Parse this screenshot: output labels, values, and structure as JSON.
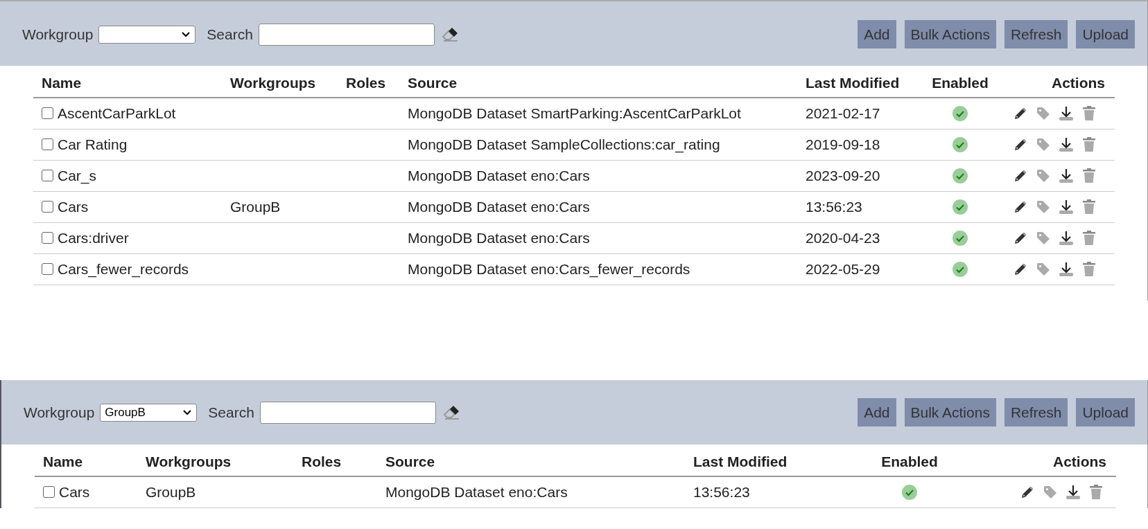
{
  "panels": [
    {
      "toolbar": {
        "workgroup_label": "Workgroup",
        "search_label": "Search",
        "buttons": [
          "Add",
          "Bulk Actions",
          "Refresh",
          "Upload"
        ]
      },
      "table": {
        "columns": [
          "Name",
          "Workgroups",
          "Roles",
          "Source",
          "Last Modified",
          "Enabled",
          "Actions"
        ],
        "rows": [
          {
            "checked": false,
            "name": "AscentCarParkLot",
            "workgroups": "",
            "roles": "",
            "source": "MongoDB Dataset SmartParking:AscentCarParkLot",
            "last_modified": "2021-02-17",
            "enabled": true
          },
          {
            "checked": false,
            "name": "Car Rating",
            "workgroups": "",
            "roles": "",
            "source": "MongoDB Dataset SampleCollections:car_rating",
            "last_modified": "2019-09-18",
            "enabled": true
          },
          {
            "checked": false,
            "name": "Car_s",
            "workgroups": "",
            "roles": "",
            "source": "MongoDB Dataset eno:Cars",
            "last_modified": "2023-09-20",
            "enabled": true
          },
          {
            "checked": false,
            "name": "Cars",
            "workgroups": "GroupB",
            "roles": "",
            "source": "MongoDB Dataset eno:Cars",
            "last_modified": "13:56:23",
            "enabled": true
          },
          {
            "checked": false,
            "name": "Cars:driver",
            "workgroups": "",
            "roles": "",
            "source": "MongoDB Dataset eno:Cars",
            "last_modified": "2020-04-23",
            "enabled": true
          },
          {
            "checked": false,
            "name": "Cars_fewer_records",
            "workgroups": "",
            "roles": "",
            "source": "MongoDB Dataset eno:Cars_fewer_records",
            "last_modified": "2022-05-29",
            "enabled": true
          }
        ]
      }
    },
    {
      "toolbar": {
        "workgroup_label": "Workgroup",
        "workgroup_value": "GroupB",
        "search_label": "Search",
        "buttons": [
          "Add",
          "Bulk Actions",
          "Refresh",
          "Upload"
        ]
      },
      "table": {
        "columns": [
          "Name",
          "Workgroups",
          "Roles",
          "Source",
          "Last Modified",
          "Enabled",
          "Actions"
        ],
        "rows": [
          {
            "checked": false,
            "name": "Cars",
            "workgroups": "GroupB",
            "roles": "",
            "source": "MongoDB Dataset eno:Cars",
            "last_modified": "13:56:23",
            "enabled": true
          }
        ]
      }
    }
  ]
}
